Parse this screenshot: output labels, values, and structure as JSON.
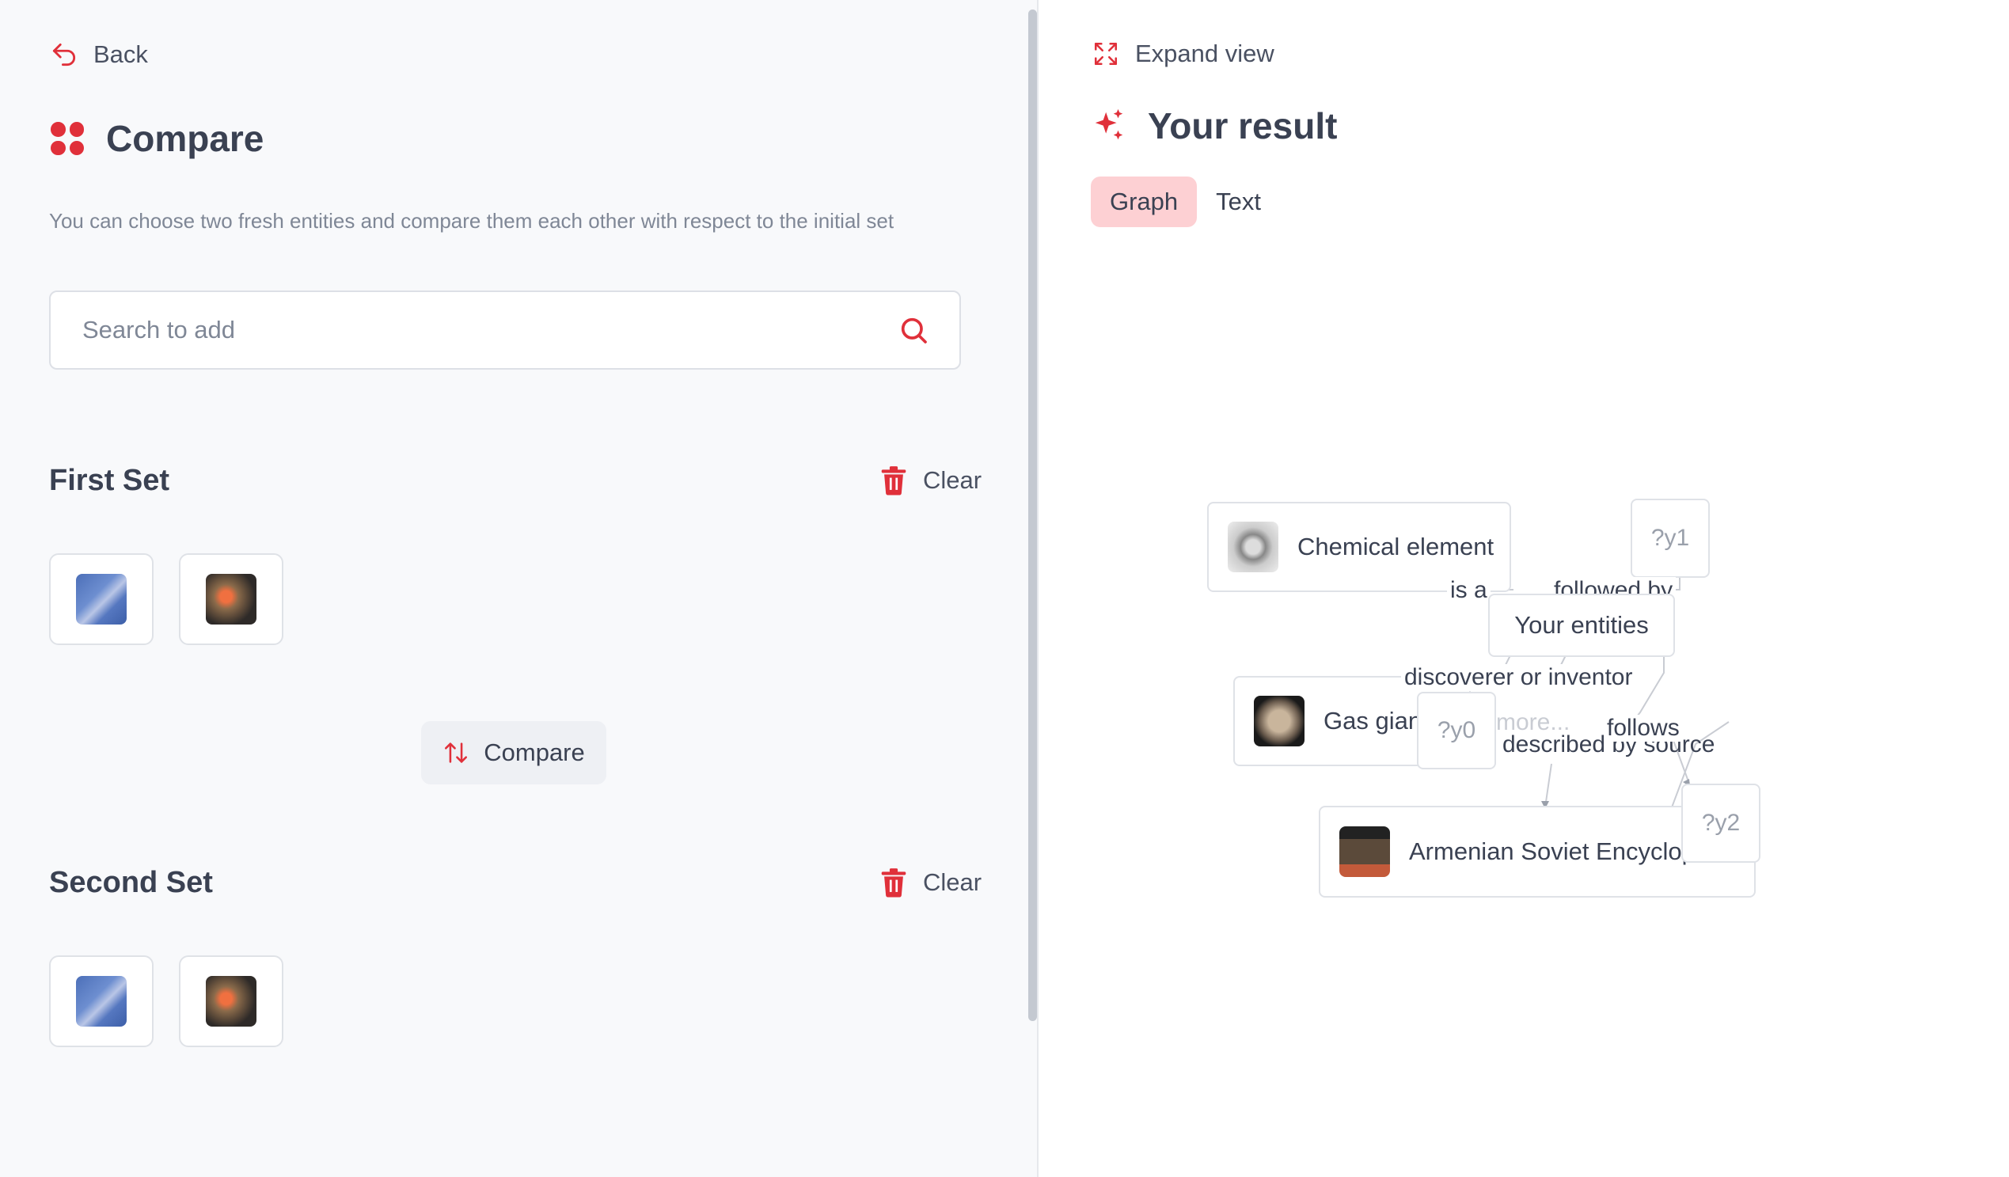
{
  "nav": {
    "back_label": "Back"
  },
  "compare_panel": {
    "title": "Compare",
    "description": "You can choose two fresh entities and compare them each other with respect to the initial set",
    "search_placeholder": "Search to add",
    "first_set": {
      "title": "First Set",
      "clear_label": "Clear"
    },
    "second_set": {
      "title": "Second Set",
      "clear_label": "Clear"
    },
    "compare_label": "Compare"
  },
  "result_panel": {
    "expand_label": "Expand view",
    "title": "Your result",
    "tabs": [
      {
        "label": "Graph",
        "active": true
      },
      {
        "label": "Text",
        "active": false
      }
    ]
  },
  "graph": {
    "nodes": {
      "chemical": "Chemical element",
      "gas": "Gas giant",
      "armenian": "Armenian Soviet Encyclopedia",
      "center": "Your entities",
      "y0": "?y0",
      "y1": "?y1",
      "y2": "?y2"
    },
    "edges": {
      "is_a": "is a",
      "followed_by": "followed by",
      "discoverer": "discoverer or inventor",
      "described_by": "described by source",
      "follows": "follows"
    },
    "ghost_text": "more..."
  },
  "colors": {
    "accent": "#e0303a",
    "active_tab_bg": "#fdd0d3"
  }
}
